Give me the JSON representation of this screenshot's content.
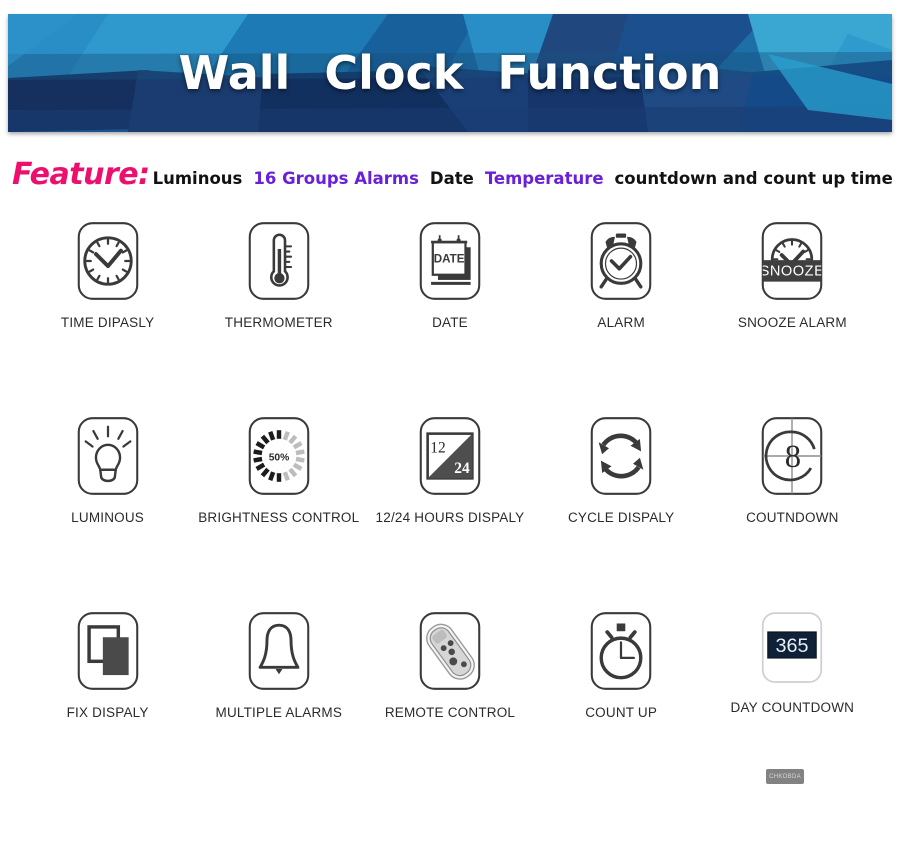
{
  "banner": {
    "title_words": [
      "Wall",
      "Clock",
      "Function"
    ],
    "bg_colors": [
      "#1b6aa8",
      "#2e8cc4",
      "#134c86",
      "#1f3f74",
      "#0f2e5c",
      "#3aa0cf",
      "#17568f",
      "#20457c"
    ]
  },
  "feature": {
    "label": "Feature:",
    "label_color": "#ec0f6e",
    "accent_color": "#6a20d8",
    "segments": [
      {
        "text": "Luminous",
        "accent": false
      },
      {
        "text": "16  Groups  Alarms",
        "accent": true
      },
      {
        "text": "Date",
        "accent": false
      },
      {
        "text": "Temperature",
        "accent": true
      },
      {
        "text": "countdown and count  up  time",
        "accent": false
      }
    ]
  },
  "features_grid": {
    "rows": [
      [
        {
          "icon": "clock-icon",
          "label": "TIME DIPASLY"
        },
        {
          "icon": "thermometer-icon",
          "label": "THERMOMETER"
        },
        {
          "icon": "calendar-date-icon",
          "label": "DATE"
        },
        {
          "icon": "alarm-clock-icon",
          "label": "ALARM"
        },
        {
          "icon": "snooze-icon",
          "label": "SNOOZE ALARM",
          "icon_text": "SNOOZE"
        }
      ],
      [
        {
          "icon": "lightbulb-icon",
          "label": "LUMINOUS"
        },
        {
          "icon": "brightness-dial-icon",
          "label": "BRIGHTNESS CONTROL",
          "icon_text": "50%"
        },
        {
          "icon": "hours-12-24-icon",
          "label": "12/24 HOURS DISPALY",
          "icon_text_a": "12",
          "icon_text_b": "24"
        },
        {
          "icon": "cycle-arrows-icon",
          "label": "CYCLE DISPALY"
        },
        {
          "icon": "film-countdown-icon",
          "label": "COUTNDOWN",
          "icon_text": "8"
        }
      ],
      [
        {
          "icon": "overlapping-squares-icon",
          "label": "FIX DISPALY"
        },
        {
          "icon": "bell-icon",
          "label": "MULTIPLE ALARMS"
        },
        {
          "icon": "remote-control-icon",
          "label": "REMOTE CONTROL"
        },
        {
          "icon": "stopwatch-icon",
          "label": "COUNT UP"
        },
        {
          "icon": "day-counter-icon",
          "label": "DAY COUNTDOWN",
          "icon_text": "365"
        }
      ]
    ]
  },
  "watermark": {
    "text": "CHKOBDA"
  },
  "colors": {
    "icon_stroke": "#3a3a3a",
    "icon_fill_dark": "#4a4a4a",
    "display_navy": "#0f2137",
    "page_bg": "#ffffff"
  }
}
